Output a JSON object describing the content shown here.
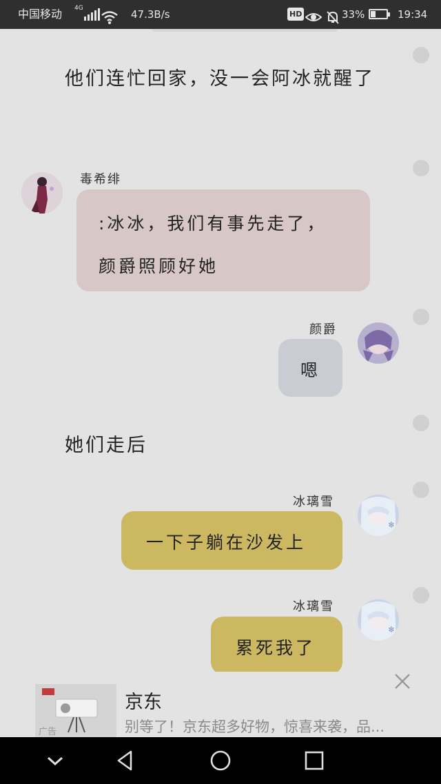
{
  "status_bar": {
    "carrier": "中国移动",
    "network": "4G",
    "speed": "47.3B/s",
    "hd_badge": "HD",
    "battery_percent": "33%",
    "battery_level": 0.33,
    "time": "19:34"
  },
  "chat": {
    "narration_1": "他们连忙回家，没一会阿冰就醒了",
    "msg_1": {
      "sender": "毒希绯",
      "line_1": ":冰冰，我们有事先走了，",
      "line_2": "颜爵照顾好她"
    },
    "msg_2": {
      "sender": "颜爵",
      "text": "嗯"
    },
    "narration_2": "她们走后",
    "msg_3": {
      "sender": "冰璃雪",
      "text": "一下子躺在沙发上"
    },
    "msg_4": {
      "sender": "冰璃雪",
      "text": "累死我了"
    }
  },
  "ad": {
    "title": "京东",
    "description": "别等了！京东超多好物，惊喜来袭，品...",
    "tag": "广告"
  },
  "colors": {
    "status_bar": "#2f2f2f",
    "background": "#e3e3e3",
    "bubble_pink": "#d8c7c7",
    "bubble_grey": "#c9ccd2",
    "bubble_yellow": "#cdb862",
    "nav_bar": "#000000"
  },
  "icons": {
    "signal": "signal-icon",
    "wifi": "wifi-icon",
    "eye": "eye-icon",
    "mute": "bell-off-icon",
    "battery": "battery-icon",
    "close": "close-icon",
    "nav_down": "chevron-down-icon",
    "nav_back": "back-triangle-icon",
    "nav_home": "home-circle-icon",
    "nav_recent": "recent-square-icon"
  }
}
